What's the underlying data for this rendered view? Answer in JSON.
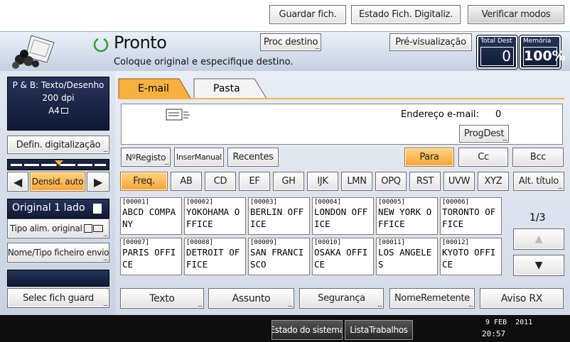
{
  "toolbar": {
    "save": "Guardar fich.",
    "scan_status": "Estado Fich. Digitaliz.",
    "check_modes": "Verificar modos"
  },
  "status": {
    "title": "Pronto",
    "message": "Coloque original e especifique destino.",
    "find_dest": "Proc destino",
    "preview": "Pré-visualização",
    "total_dest_label": "Total Dest",
    "total_dest_value": "0",
    "memory_label": "Memória",
    "memory_value": "100%"
  },
  "left": {
    "info_line1": "P & B: Texto/Desenho",
    "info_line2": "200 dpi",
    "info_line3": "A4",
    "scan_settings": "Defin. digitalização",
    "density": "Densid. auto",
    "original": "Original 1 lado",
    "feed_type": "Tipo alim. original",
    "file_name": "Nome/Tipo ficheiro envio",
    "select_stored": "Selec fich guard"
  },
  "tabs": {
    "email": "E-mail",
    "folder": "Pasta"
  },
  "dest": {
    "email_label": "Endereço e-mail:",
    "email_count": "0",
    "prog_dest": "ProgDest"
  },
  "entry": {
    "reg_no": "NºRegisto",
    "manual": "InserManual",
    "recent": "Recentes",
    "to": "Para",
    "cc": "Cc",
    "bcc": "Bcc"
  },
  "index": [
    "Freq.",
    "AB",
    "CD",
    "EF",
    "GH",
    "IJK",
    "LMN",
    "OPQ",
    "RST",
    "UVW",
    "XYZ"
  ],
  "alt_title": "Alt. título",
  "addresses": [
    {
      "code": "[00001]",
      "l1": "ABCD COMPA",
      "l2": "NY"
    },
    {
      "code": "[00002]",
      "l1": "YOKOHAMA O",
      "l2": "FFICE"
    },
    {
      "code": "[00003]",
      "l1": "BERLIN OFF",
      "l2": "ICE"
    },
    {
      "code": "[00004]",
      "l1": "LONDON OFF",
      "l2": "ICE"
    },
    {
      "code": "[00005]",
      "l1": "NEW YORK O",
      "l2": "FFICE"
    },
    {
      "code": "[00006]",
      "l1": "TORONTO OF",
      "l2": "FICE"
    },
    {
      "code": "[00007]",
      "l1": "PARIS OFFI",
      "l2": "CE"
    },
    {
      "code": "[00008]",
      "l1": "DETROIT OF",
      "l2": "FICE"
    },
    {
      "code": "[00009]",
      "l1": "SAN FRANCI",
      "l2": "SCO"
    },
    {
      "code": "[00010]",
      "l1": "OSAKA OFFI",
      "l2": "CE"
    },
    {
      "code": "[00011]",
      "l1": "LOS ANGELE",
      "l2": "S"
    },
    {
      "code": "[00012]",
      "l1": "KYOTO OFFI",
      "l2": "CE"
    }
  ],
  "pager": "1/3",
  "bottom": {
    "text": "Texto",
    "subject": "Assunto",
    "security": "Segurança",
    "sender": "NomeRemetente",
    "receipt": "Aviso RX"
  },
  "footer": {
    "system_status": "Estado do sistema",
    "job_list": "ListaTrabalhos",
    "date": "9 FEB  2011",
    "time": "20:57"
  }
}
